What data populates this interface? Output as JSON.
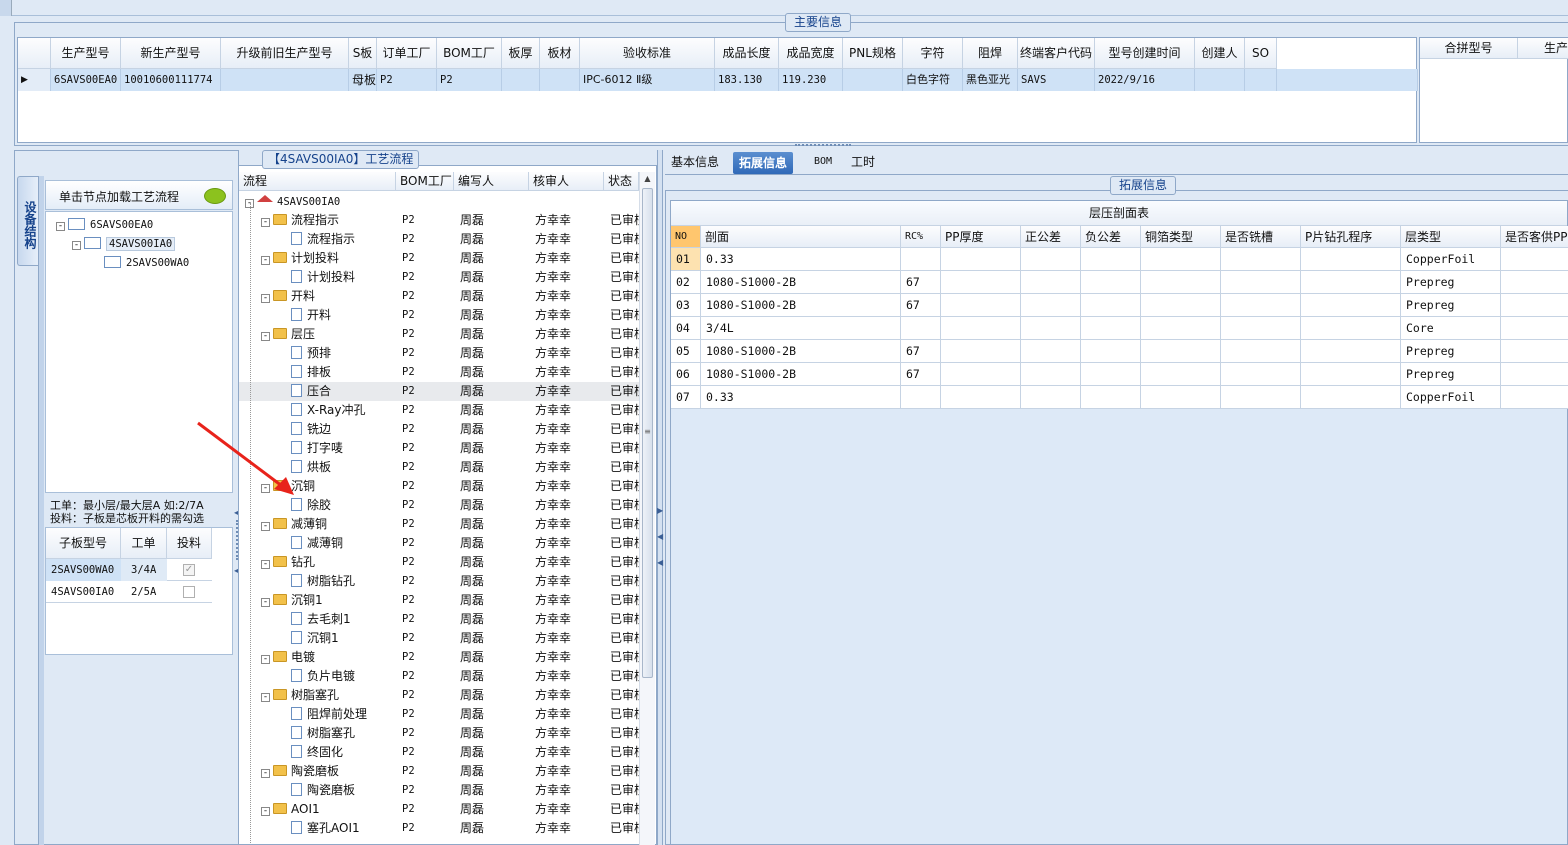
{
  "main_info_title": "主要信息",
  "top_grid": {
    "headers": [
      "生产型号",
      "新生产型号",
      "升级前旧生产型号",
      "S板",
      "订单工厂",
      "BOM工厂",
      "板厚",
      "板材",
      "验收标准",
      "成品长度",
      "成品宽度",
      "PNL规格",
      "字符",
      "阻焊",
      "终端客户代码",
      "型号创建时间",
      "创建人",
      "SO"
    ],
    "row": [
      "6SAVS00EA0",
      "10010600111774",
      "",
      "母板",
      "P2",
      "P2",
      "",
      "",
      "IPC-6012 Ⅱ级",
      "183.130",
      "119.230",
      "",
      "白色字符",
      "黑色亚光",
      "SAVS",
      "2022/9/16",
      "",
      ""
    ],
    "right_headers": [
      "合拼型号",
      "生产"
    ]
  },
  "left_panel": {
    "side_tab": "设备结构",
    "hint": "单击节点加载工艺流程",
    "tree": [
      "6SAVS00EA0",
      "4SAVS00IA0",
      "2SAVS00WA0"
    ],
    "note1": "工单：最小层/最大层A 如:2/7A",
    "note2": "投料：子板是芯板开料的需勾选",
    "sub_headers": [
      "子板型号",
      "工单",
      "投料"
    ],
    "sub_rows": [
      [
        "2SAVS00WA0",
        "3/4A",
        "checked"
      ],
      [
        "4SAVS00IA0",
        "2/5A",
        "unchecked"
      ]
    ]
  },
  "process": {
    "title": "【4SAVS00IA0】工艺流程",
    "headers": [
      "流程",
      "BOM工厂",
      "编写人",
      "核审人",
      "状态"
    ],
    "root": "4SAVS00IA0",
    "rows": [
      {
        "name": "流程指示",
        "lvl": 1,
        "bom": "P2",
        "w": "周磊",
        "r": "方幸幸",
        "s": "已审核"
      },
      {
        "name": "流程指示",
        "lvl": 2,
        "bom": "P2",
        "w": "周磊",
        "r": "方幸幸",
        "s": "已审核"
      },
      {
        "name": "计划投料",
        "lvl": 1,
        "bom": "P2",
        "w": "周磊",
        "r": "方幸幸",
        "s": "已审核"
      },
      {
        "name": "计划投料",
        "lvl": 2,
        "bom": "P2",
        "w": "周磊",
        "r": "方幸幸",
        "s": "已审核"
      },
      {
        "name": "开料",
        "lvl": 1,
        "bom": "P2",
        "w": "周磊",
        "r": "方幸幸",
        "s": "已审核"
      },
      {
        "name": "开料",
        "lvl": 2,
        "bom": "P2",
        "w": "周磊",
        "r": "方幸幸",
        "s": "已审核"
      },
      {
        "name": "层压",
        "lvl": 1,
        "bom": "P2",
        "w": "周磊",
        "r": "方幸幸",
        "s": "已审核"
      },
      {
        "name": "预排",
        "lvl": 2,
        "bom": "P2",
        "w": "周磊",
        "r": "方幸幸",
        "s": "已审核"
      },
      {
        "name": "排板",
        "lvl": 2,
        "bom": "P2",
        "w": "周磊",
        "r": "方幸幸",
        "s": "已审核"
      },
      {
        "name": "压合",
        "lvl": 2,
        "bom": "P2",
        "w": "周磊",
        "r": "方幸幸",
        "s": "已审核",
        "sel": true
      },
      {
        "name": "X-Ray冲孔",
        "lvl": 2,
        "bom": "P2",
        "w": "周磊",
        "r": "方幸幸",
        "s": "已审核"
      },
      {
        "name": "铣边",
        "lvl": 2,
        "bom": "P2",
        "w": "周磊",
        "r": "方幸幸",
        "s": "已审核"
      },
      {
        "name": "打字唛",
        "lvl": 2,
        "bom": "P2",
        "w": "周磊",
        "r": "方幸幸",
        "s": "已审核"
      },
      {
        "name": "烘板",
        "lvl": 2,
        "bom": "P2",
        "w": "周磊",
        "r": "方幸幸",
        "s": "已审核"
      },
      {
        "name": "沉铜",
        "lvl": 1,
        "bom": "P2",
        "w": "周磊",
        "r": "方幸幸",
        "s": "已审核"
      },
      {
        "name": "除胶",
        "lvl": 2,
        "bom": "P2",
        "w": "周磊",
        "r": "方幸幸",
        "s": "已审核"
      },
      {
        "name": "减薄铜",
        "lvl": 1,
        "bom": "P2",
        "w": "周磊",
        "r": "方幸幸",
        "s": "已审核"
      },
      {
        "name": "减薄铜",
        "lvl": 2,
        "bom": "P2",
        "w": "周磊",
        "r": "方幸幸",
        "s": "已审核"
      },
      {
        "name": "钻孔",
        "lvl": 1,
        "bom": "P2",
        "w": "周磊",
        "r": "方幸幸",
        "s": "已审核"
      },
      {
        "name": "树脂钻孔",
        "lvl": 2,
        "bom": "P2",
        "w": "周磊",
        "r": "方幸幸",
        "s": "已审核"
      },
      {
        "name": "沉铜1",
        "lvl": 1,
        "bom": "P2",
        "w": "周磊",
        "r": "方幸幸",
        "s": "已审核"
      },
      {
        "name": "去毛刺1",
        "lvl": 2,
        "bom": "P2",
        "w": "周磊",
        "r": "方幸幸",
        "s": "已审核"
      },
      {
        "name": "沉铜1",
        "lvl": 2,
        "bom": "P2",
        "w": "周磊",
        "r": "方幸幸",
        "s": "已审核"
      },
      {
        "name": "电镀",
        "lvl": 1,
        "bom": "P2",
        "w": "周磊",
        "r": "方幸幸",
        "s": "已审核"
      },
      {
        "name": "负片电镀",
        "lvl": 2,
        "bom": "P2",
        "w": "周磊",
        "r": "方幸幸",
        "s": "已审核"
      },
      {
        "name": "树脂塞孔",
        "lvl": 1,
        "bom": "P2",
        "w": "周磊",
        "r": "方幸幸",
        "s": "已审核"
      },
      {
        "name": "阻焊前处理",
        "lvl": 2,
        "bom": "P2",
        "w": "周磊",
        "r": "方幸幸",
        "s": "已审核"
      },
      {
        "name": "树脂塞孔",
        "lvl": 2,
        "bom": "P2",
        "w": "周磊",
        "r": "方幸幸",
        "s": "已审核"
      },
      {
        "name": "终固化",
        "lvl": 2,
        "bom": "P2",
        "w": "周磊",
        "r": "方幸幸",
        "s": "已审核"
      },
      {
        "name": "陶瓷磨板",
        "lvl": 1,
        "bom": "P2",
        "w": "周磊",
        "r": "方幸幸",
        "s": "已审核"
      },
      {
        "name": "陶瓷磨板",
        "lvl": 2,
        "bom": "P2",
        "w": "周磊",
        "r": "方幸幸",
        "s": "已审核"
      },
      {
        "name": "AOI1",
        "lvl": 1,
        "bom": "P2",
        "w": "周磊",
        "r": "方幸幸",
        "s": "已审核"
      },
      {
        "name": "塞孔AOI1",
        "lvl": 2,
        "bom": "P2",
        "w": "周磊",
        "r": "方幸幸",
        "s": "已审核"
      }
    ]
  },
  "right_panel": {
    "tabs": [
      "基本信息",
      "拓展信息",
      "BOM",
      "工时"
    ],
    "active_tab": 1,
    "group_title": "拓展信息",
    "table_title": "层压剖面表",
    "headers": [
      "NO",
      "剖面",
      "RC%",
      "PP厚度",
      "正公差",
      "负公差",
      "铜箔类型",
      "是否铣槽",
      "P片钻孔程序",
      "层类型",
      "是否客供PP"
    ],
    "rows": [
      [
        "01",
        "0.33",
        "",
        "",
        "",
        "",
        "",
        "",
        "",
        "CopperFoil",
        ""
      ],
      [
        "02",
        "1080-S1000-2B",
        "67",
        "",
        "",
        "",
        "",
        "",
        "",
        "Prepreg",
        ""
      ],
      [
        "03",
        "1080-S1000-2B",
        "67",
        "",
        "",
        "",
        "",
        "",
        "",
        "Prepreg",
        ""
      ],
      [
        "04",
        "3/4L",
        "",
        "",
        "",
        "",
        "",
        "",
        "",
        "Core",
        ""
      ],
      [
        "05",
        "1080-S1000-2B",
        "67",
        "",
        "",
        "",
        "",
        "",
        "",
        "Prepreg",
        ""
      ],
      [
        "06",
        "1080-S1000-2B",
        "67",
        "",
        "",
        "",
        "",
        "",
        "",
        "Prepreg",
        ""
      ],
      [
        "07",
        "0.33",
        "",
        "",
        "",
        "",
        "",
        "",
        "",
        "CopperFoil",
        ""
      ]
    ]
  }
}
